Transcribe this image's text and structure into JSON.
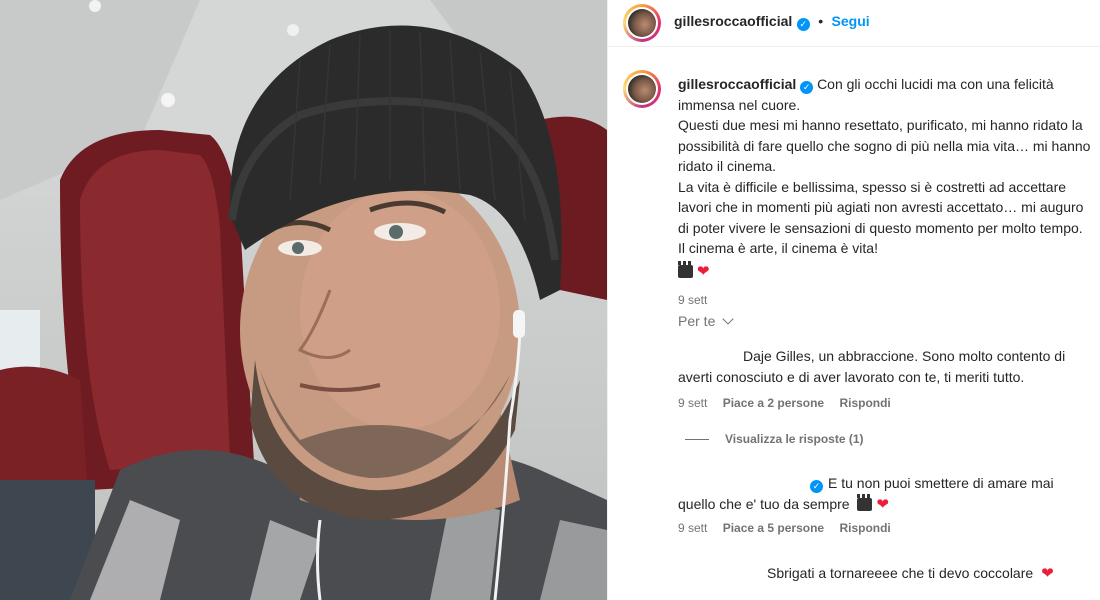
{
  "header": {
    "username": "gillesroccaofficial",
    "separator": "•",
    "follow_label": "Segui"
  },
  "post": {
    "username": "gillesroccaofficial",
    "caption_line1": "Con gli occhi lucidi ma con una felicità immensa nel cuore.",
    "caption_line2": "Questi due mesi mi hanno resettato, purificato, mi hanno ridato la possibilità di fare quello che sogno di più nella mia vita… mi hanno ridato il cinema.",
    "caption_line3": "La vita è difficile e bellissima, spesso si è costretti ad accettare lavori che in momenti più agiati non avresti accettato… mi auguro di poter vivere le sensazioni di questo momento per molto tempo. Il cinema è arte, il cinema è vita!",
    "caption_emojis": "🎬❤️",
    "time": "9 sett"
  },
  "per_te_label": "Per te",
  "comments": [
    {
      "text": "Daje Gilles, un abbraccione. Sono molto contento di averti conosciuto e di aver lavorato con te, ti meriti tutto.",
      "time": "9 sett",
      "likes": "Piace a 2 persone",
      "reply": "Rispondi",
      "view_replies": "Visualizza le risposte (1)"
    },
    {
      "text": "E tu non puoi smettere di amare mai quello che e' tuo da sempre",
      "time": "9 sett",
      "likes": "Piace a 5 persone",
      "reply": "Rispondi"
    },
    {
      "text": "Sbrigati a tornareeee che ti devo coccolare"
    }
  ],
  "colors": {
    "accent": "#0095f6",
    "text": "#262626",
    "secondary": "#737373",
    "heart": "#ed1d3a"
  },
  "icons": {
    "verified": "verified-badge-icon",
    "chevron": "chevron-down-icon",
    "heart": "heart-icon",
    "clapper": "clapper-board-icon"
  }
}
